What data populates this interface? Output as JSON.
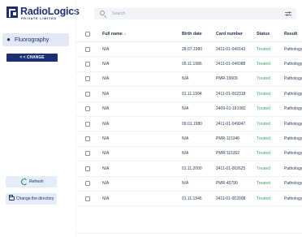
{
  "app": {
    "logo_text": "RadioLogics",
    "logo_subtitle": "PRIVATE LIMITED"
  },
  "sidebar": {
    "modality_label": "Fluorography",
    "change_label": "< < CHANGE",
    "refresh_label": "Refresh",
    "change_directory_label": "Change the directory"
  },
  "search": {
    "placeholder": "Search",
    "value": ""
  },
  "table": {
    "columns": {
      "full_name": "Full name",
      "birth_date": "Birth date",
      "card_number": "Card number",
      "status": "Status",
      "result": "Result"
    },
    "rows": [
      {
        "name": "N/A",
        "birth": "28.07.1980",
        "card": "2411-01-049143",
        "status": "Treated",
        "result": "Pathology"
      },
      {
        "name": "N/A",
        "birth": "05.11.1986",
        "card": "2411-01-046088",
        "status": "Treated",
        "result": "Pathology"
      },
      {
        "name": "N/A",
        "birth": "N/A",
        "card": "PMR-19609",
        "status": "Treated",
        "result": "Pathology"
      },
      {
        "name": "N/A",
        "birth": "01.11.1994",
        "card": "2411-01-002318",
        "status": "Treated",
        "result": "Pathology"
      },
      {
        "name": "N/A",
        "birth": "N/A",
        "card": "2409-01-181082",
        "status": "Treated",
        "result": "Pathology"
      },
      {
        "name": "N/A",
        "birth": "09.01.1980",
        "card": "2411-01-049047",
        "status": "Treated",
        "result": "Pathology"
      },
      {
        "name": "N/A",
        "birth": "N/A",
        "card": "PMR-115346",
        "status": "Treated",
        "result": "Pathology"
      },
      {
        "name": "N/A",
        "birth": "N/A",
        "card": "PMR-115352",
        "status": "Treated",
        "result": "Pathology"
      },
      {
        "name": "N/A",
        "birth": "01.11.2000",
        "card": "2411-01-002625",
        "status": "Treated",
        "result": "Pathology"
      },
      {
        "name": "N/A",
        "birth": "N/A",
        "card": "PMR-45790",
        "status": "Treated",
        "result": "Pathology"
      },
      {
        "name": "N/A",
        "birth": "01.11.1946",
        "card": "2411-01-002008",
        "status": "Treated",
        "result": "Pathology"
      }
    ]
  },
  "colors": {
    "brand": "#1c2f73",
    "treated": "#38a86a",
    "sidebar_active": "#e3e8f6"
  }
}
